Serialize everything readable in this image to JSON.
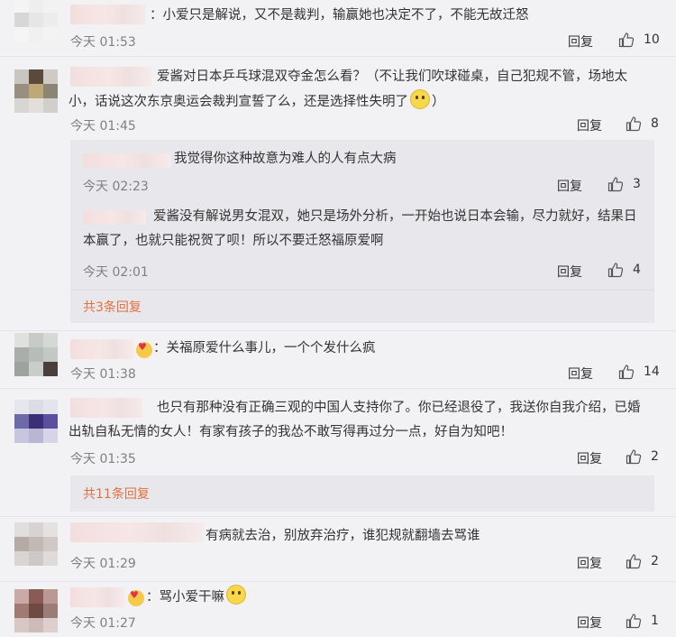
{
  "labels": {
    "reply": "回复"
  },
  "comments": [
    {
      "text": "：小爱只是解说，又不是裁判，输赢她也决定不了，不能无故迁怒",
      "time": "今天 01:53",
      "likes": "10"
    },
    {
      "text": "爱酱对日本乒乓球混双夺金怎么看？（不让我们吹球碰桌，自己犯规不管，场地太小，话说这次东京奥运会裁判宣誓了么，还是选择性失明了",
      "text_end": "）",
      "time": "今天 01:45",
      "likes": "8",
      "replies": [
        {
          "text": "我觉得你这种故意为难人的人有点大病",
          "time": "今天 02:23",
          "likes": "3"
        },
        {
          "text": "爱酱没有解说男女混双，她只是场外分析，一开始也说日本会输，尽力就好，结果日本赢了，也就只能祝贺了呗！所以不要迁怒福原爱啊",
          "time": "今天 02:01",
          "likes": "4"
        }
      ],
      "more": "共3条回复"
    },
    {
      "text": "：关福原爱什么事儿，一个个发什么疯",
      "time": "今天 01:38",
      "likes": "14"
    },
    {
      "text": "也只有那种没有正确三观的中国人支持你了。你已经退役了，我送你自我介绍，已婚出轨自私无情的女人！有家有孩子的我怂不敢写得再过分一点，好自为知吧！",
      "time": "今天 01:35",
      "likes": "2",
      "more": "共11条回复"
    },
    {
      "text": "有病就去治，别放弃治疗，谁犯规就翻墙去骂谁",
      "time": "今天 01:29",
      "likes": "2"
    },
    {
      "text": "：骂小爱干嘛",
      "time": "今天 01:27",
      "likes": "1"
    }
  ],
  "colors": {
    "link": "#e0703c",
    "time": "#808080",
    "subbox": "#e8e8ec"
  },
  "icons": {
    "like": "thumbs-up-icon",
    "emoji_smile": "smile-emoji-icon",
    "emoji_heart": "heart-eyes-emoji-icon",
    "emoji_doge": "doge-emoji-icon"
  }
}
